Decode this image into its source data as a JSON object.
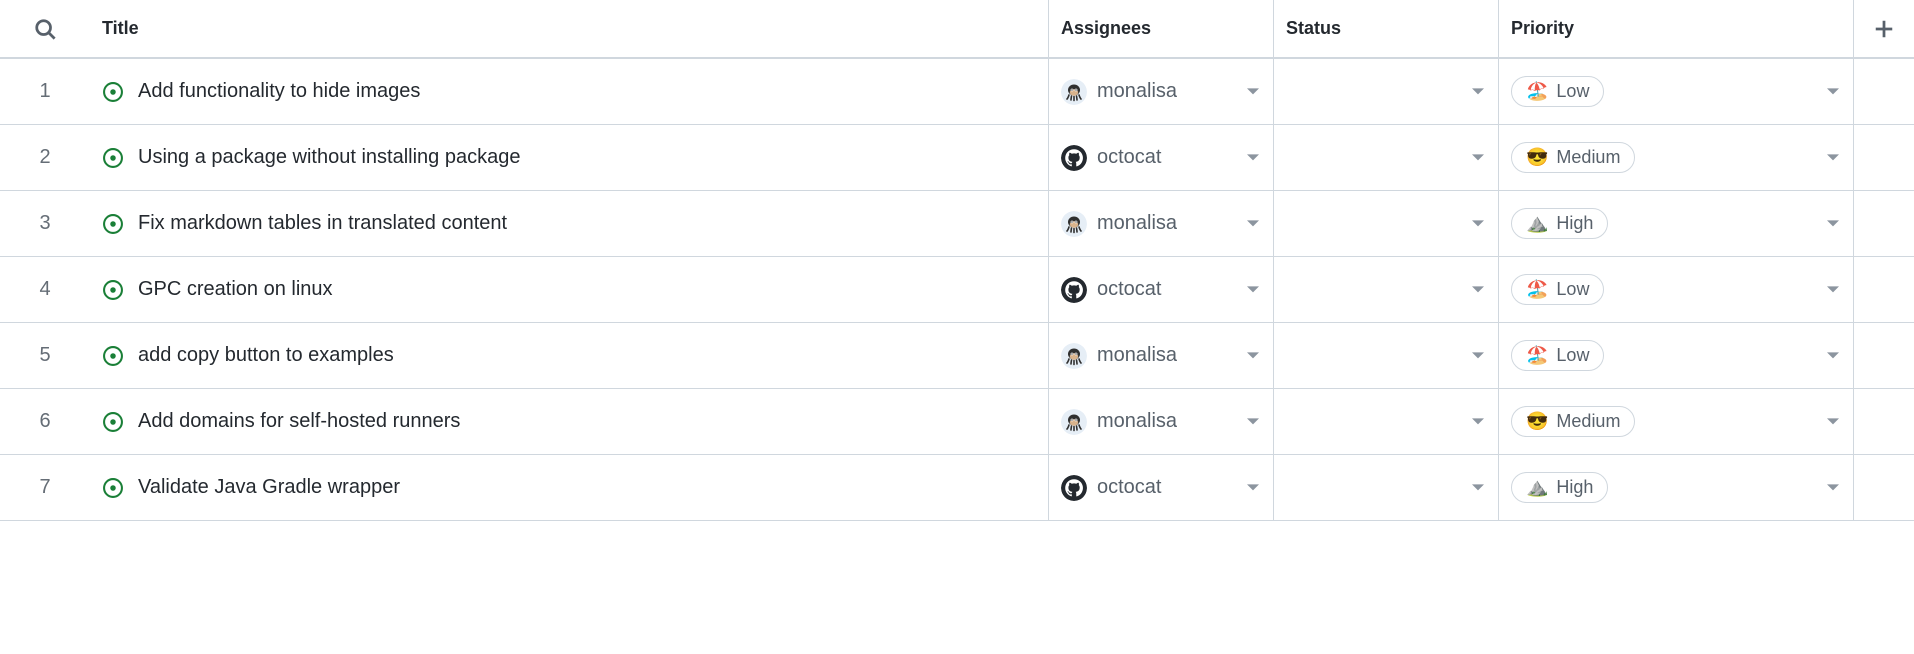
{
  "columns": {
    "title": "Title",
    "assignees": "Assignees",
    "status": "Status",
    "priority": "Priority"
  },
  "priorities": {
    "low": {
      "label": "Low",
      "emoji": "🏖️"
    },
    "medium": {
      "label": "Medium",
      "emoji": "😎"
    },
    "high": {
      "label": "High",
      "emoji": "⛰️"
    }
  },
  "assignees_meta": {
    "monalisa": {
      "name": "monalisa",
      "avatar": "octopus"
    },
    "octocat": {
      "name": "octocat",
      "avatar": "github"
    }
  },
  "rows": [
    {
      "num": "1",
      "title": "Add functionality to hide images",
      "assignee": "monalisa",
      "status": "",
      "priority": "low"
    },
    {
      "num": "2",
      "title": "Using a package without installing package",
      "assignee": "octocat",
      "status": "",
      "priority": "medium"
    },
    {
      "num": "3",
      "title": "Fix markdown tables in translated content",
      "assignee": "monalisa",
      "status": "",
      "priority": "high"
    },
    {
      "num": "4",
      "title": "GPC creation on linux",
      "assignee": "octocat",
      "status": "",
      "priority": "low"
    },
    {
      "num": "5",
      "title": "add copy button to examples",
      "assignee": "monalisa",
      "status": "",
      "priority": "low"
    },
    {
      "num": "6",
      "title": "Add domains for self-hosted runners",
      "assignee": "monalisa",
      "status": "",
      "priority": "medium"
    },
    {
      "num": "7",
      "title": "Validate Java Gradle wrapper",
      "assignee": "octocat",
      "status": "",
      "priority": "high"
    }
  ]
}
